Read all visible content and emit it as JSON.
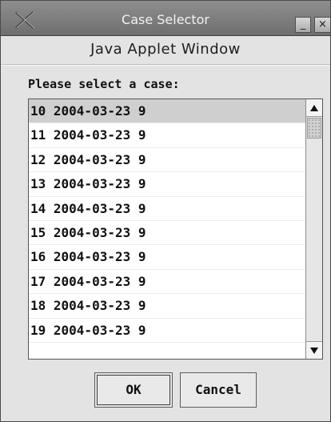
{
  "window": {
    "title": "Case Selector",
    "minimize_glyph": "_",
    "close_glyph": "×",
    "applet_label": "Java Applet Window"
  },
  "dialog": {
    "prompt": "Please select a case:",
    "selected_index": 0,
    "cases": [
      "10 2004-03-23 9",
      "11 2004-03-23 9",
      "12 2004-03-23 9",
      "13 2004-03-23 9",
      "14 2004-03-23 9",
      "15 2004-03-23 9",
      "16 2004-03-23 9",
      "17 2004-03-23 9",
      "18 2004-03-23 9",
      "19 2004-03-23 9"
    ],
    "ok_label": "OK",
    "cancel_label": "Cancel"
  },
  "icons": {
    "app": "x-window-icon",
    "minimize": "minimize-icon",
    "close": "close-icon",
    "scroll_up": "arrow-up-icon",
    "scroll_down": "arrow-down-icon"
  },
  "colors": {
    "titlebar": "#7f7f7f",
    "window_bg": "#e3e3e3",
    "selection": "#cfcfcf"
  }
}
